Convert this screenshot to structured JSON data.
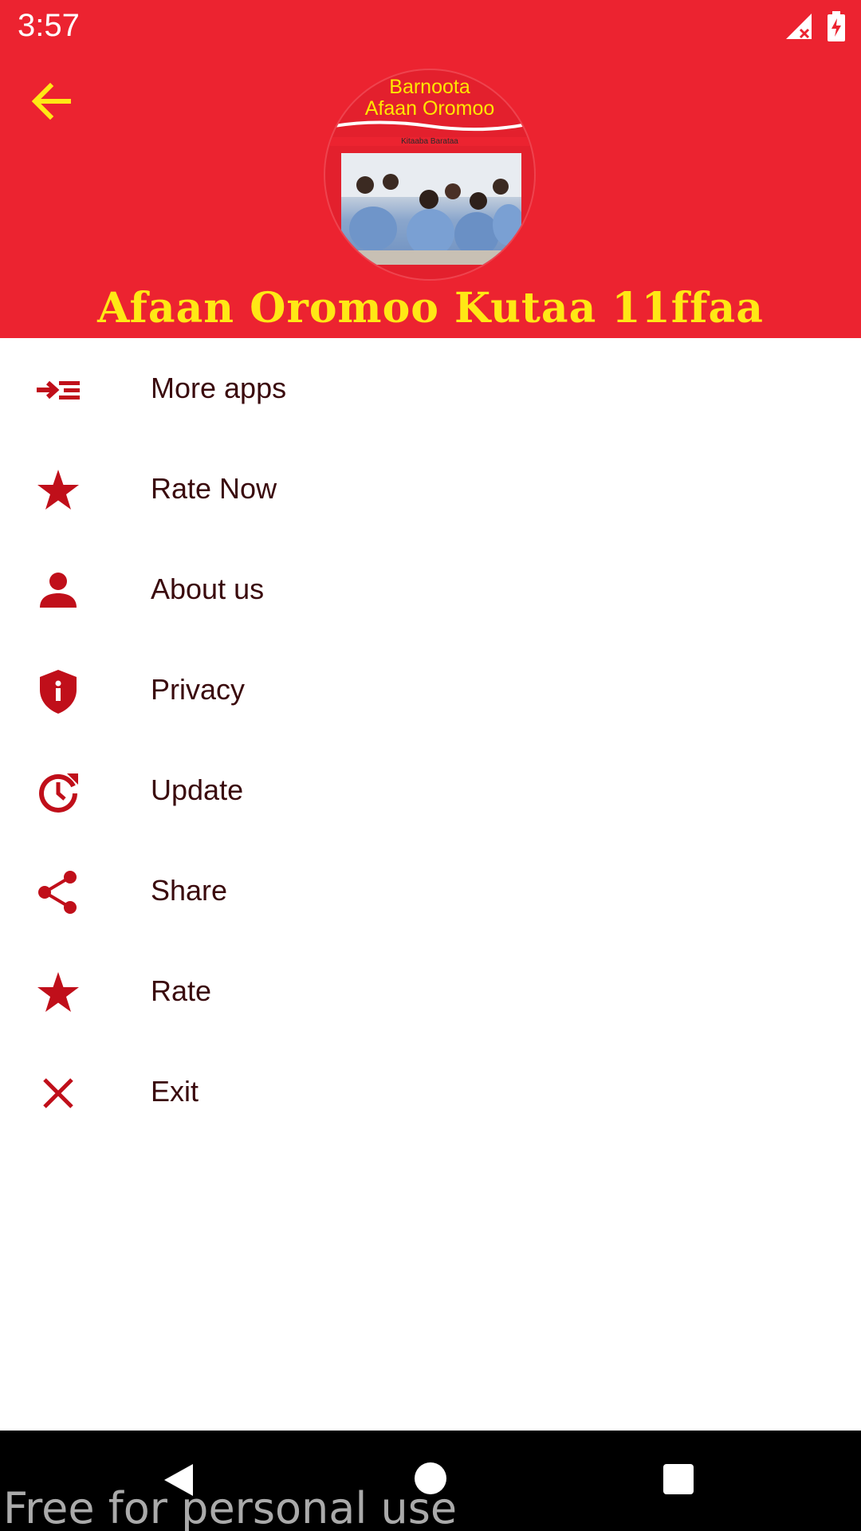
{
  "status_bar": {
    "time": "3:57"
  },
  "header": {
    "title": "Afaan Oromoo Kutaa 11ffaa",
    "logo": {
      "line1": "Barnoota",
      "line2": "Afaan Oromoo",
      "subtitle": "Kitaaba Barataa"
    }
  },
  "menu": {
    "items": [
      {
        "label": "More apps",
        "icon": "more-apps-icon"
      },
      {
        "label": "Rate Now",
        "icon": "star-icon"
      },
      {
        "label": "About us",
        "icon": "person-icon"
      },
      {
        "label": "Privacy",
        "icon": "shield-info-icon"
      },
      {
        "label": "Update",
        "icon": "update-icon"
      },
      {
        "label": "Share",
        "icon": "share-icon"
      },
      {
        "label": "Rate",
        "icon": "star-icon"
      },
      {
        "label": "Exit",
        "icon": "close-icon"
      }
    ]
  },
  "watermark": "Free for personal use",
  "colors": {
    "header_bg": "#ec2330",
    "accent_yellow": "#ffe815",
    "icon_red": "#c00f1a",
    "label_text": "#3a0a0d"
  }
}
